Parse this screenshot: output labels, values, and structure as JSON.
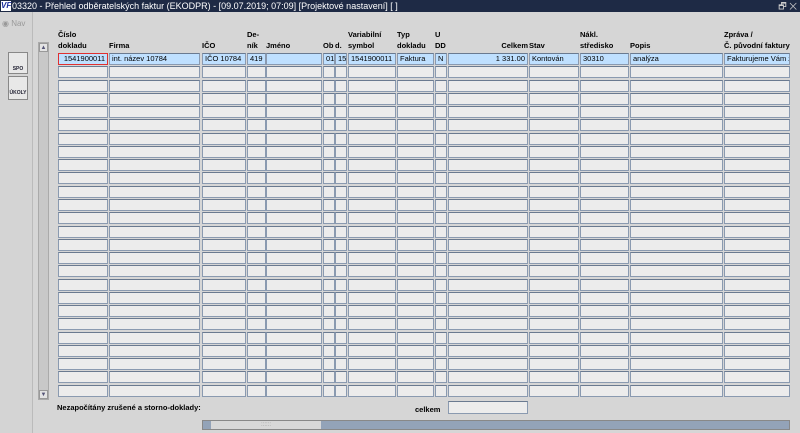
{
  "window": {
    "title": "03320 - Přehled odběratelských faktur (EKODPR) - [09.07.2019; 07:09]  [Projektové nastavení]  [ ]",
    "icon": "VF",
    "restore": "🗗",
    "close": "✕"
  },
  "toolbar": {
    "nav": "Nav",
    "spo": "SPO",
    "ukoly": "ÚKOLY"
  },
  "columns": [
    {
      "key": "cislo",
      "label": "Číslo\ndokladu"
    },
    {
      "key": "firma",
      "label": "\nFirma"
    },
    {
      "key": "ico",
      "label": "\nIČO"
    },
    {
      "key": "denik",
      "label": "De-\nník"
    },
    {
      "key": "jmeno",
      "label": "\nJméno"
    },
    {
      "key": "ob",
      "label": "\nOb"
    },
    {
      "key": "d",
      "label": "\nd."
    },
    {
      "key": "vs",
      "label": "Variabilní\nsymbol"
    },
    {
      "key": "typ",
      "label": "Typ\ndokladu"
    },
    {
      "key": "udd",
      "label": "U\nDD"
    },
    {
      "key": "celkem",
      "label": "\nCelkem"
    },
    {
      "key": "stav",
      "label": "\nStav"
    },
    {
      "key": "nakl",
      "label": "Nákl.\nstředisko"
    },
    {
      "key": "popis",
      "label": "\nPopis"
    },
    {
      "key": "zprava",
      "label": "Zpráva /\nČ. původní faktury"
    }
  ],
  "rows": [
    {
      "cislo": "1541900011",
      "firma": "int. název 10784",
      "ico": "IČO 10784",
      "denik": "419",
      "jmeno": "",
      "ob": "01",
      "d": "15",
      "vs": "1541900011",
      "typ": "Faktura",
      "udd": "N",
      "celkem": "1 331.00",
      "stav": "Kontován",
      "nakl": "30310",
      "popis": "analýza",
      "zprava": "Fakturujeme Vám za"
    }
  ],
  "empty_rows": 25,
  "footer": {
    "note": "Nezapočítány zrušené a storno-doklady:",
    "total_label": "celkem",
    "total_value": ""
  }
}
